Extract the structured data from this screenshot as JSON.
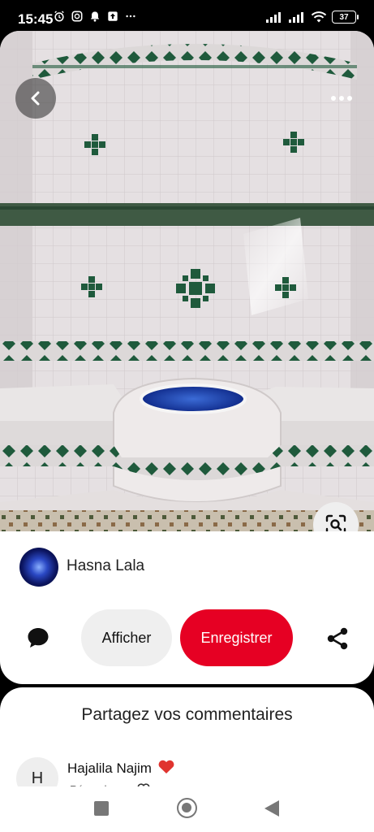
{
  "status_bar": {
    "time": "15:45",
    "battery": "37",
    "icons": [
      "alarm-icon",
      "instagram-icon",
      "notification-bell-icon",
      "upload-icon",
      "more-dots-icon",
      "signal-icon",
      "wifi-icon",
      "battery-icon"
    ]
  },
  "photo": {
    "description_icons": [
      "back-arrow-icon",
      "more-options-icon",
      "visual-search-icon"
    ]
  },
  "author": {
    "name": "Hasna Lala"
  },
  "actions": {
    "show_label": "Afficher",
    "save_label": "Enregistrer"
  },
  "comments": {
    "title": "Partagez vos commentaires",
    "items": [
      {
        "initial": "H",
        "author": "Hajalila Najim",
        "reply_label": "Répondre"
      }
    ]
  },
  "colors": {
    "save_button": "#e60023",
    "tile_green": "#1f5a3c",
    "pool_blue": "#1d3fa8"
  }
}
